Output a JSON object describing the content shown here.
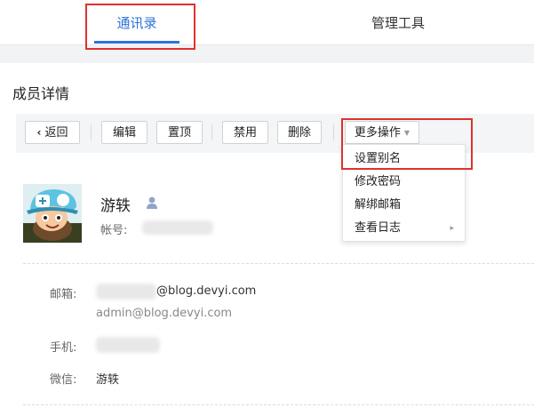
{
  "nav": {
    "tabs": [
      {
        "label": "通讯录",
        "active": true
      },
      {
        "label": "管理工具",
        "active": false
      }
    ]
  },
  "page": {
    "title": "成员详情"
  },
  "toolbar": {
    "back_label": "返回",
    "edit_label": "编辑",
    "top_label": "置顶",
    "disable_label": "禁用",
    "delete_label": "删除",
    "more_label": "更多操作"
  },
  "dropdown": {
    "items": [
      "设置别名",
      "修改密码",
      "解绑邮箱",
      "查看日志"
    ]
  },
  "member": {
    "name": "游轶",
    "account_label": "帐号:"
  },
  "details": {
    "email_label": "邮箱:",
    "email_domain": "@blog.devyi.com",
    "email_alias": "admin@blog.devyi.com",
    "phone_label": "手机:",
    "wechat_label": "微信:",
    "wechat_value": "游轶"
  },
  "colors": {
    "accent": "#2d72d9",
    "highlight": "#e0312e"
  }
}
